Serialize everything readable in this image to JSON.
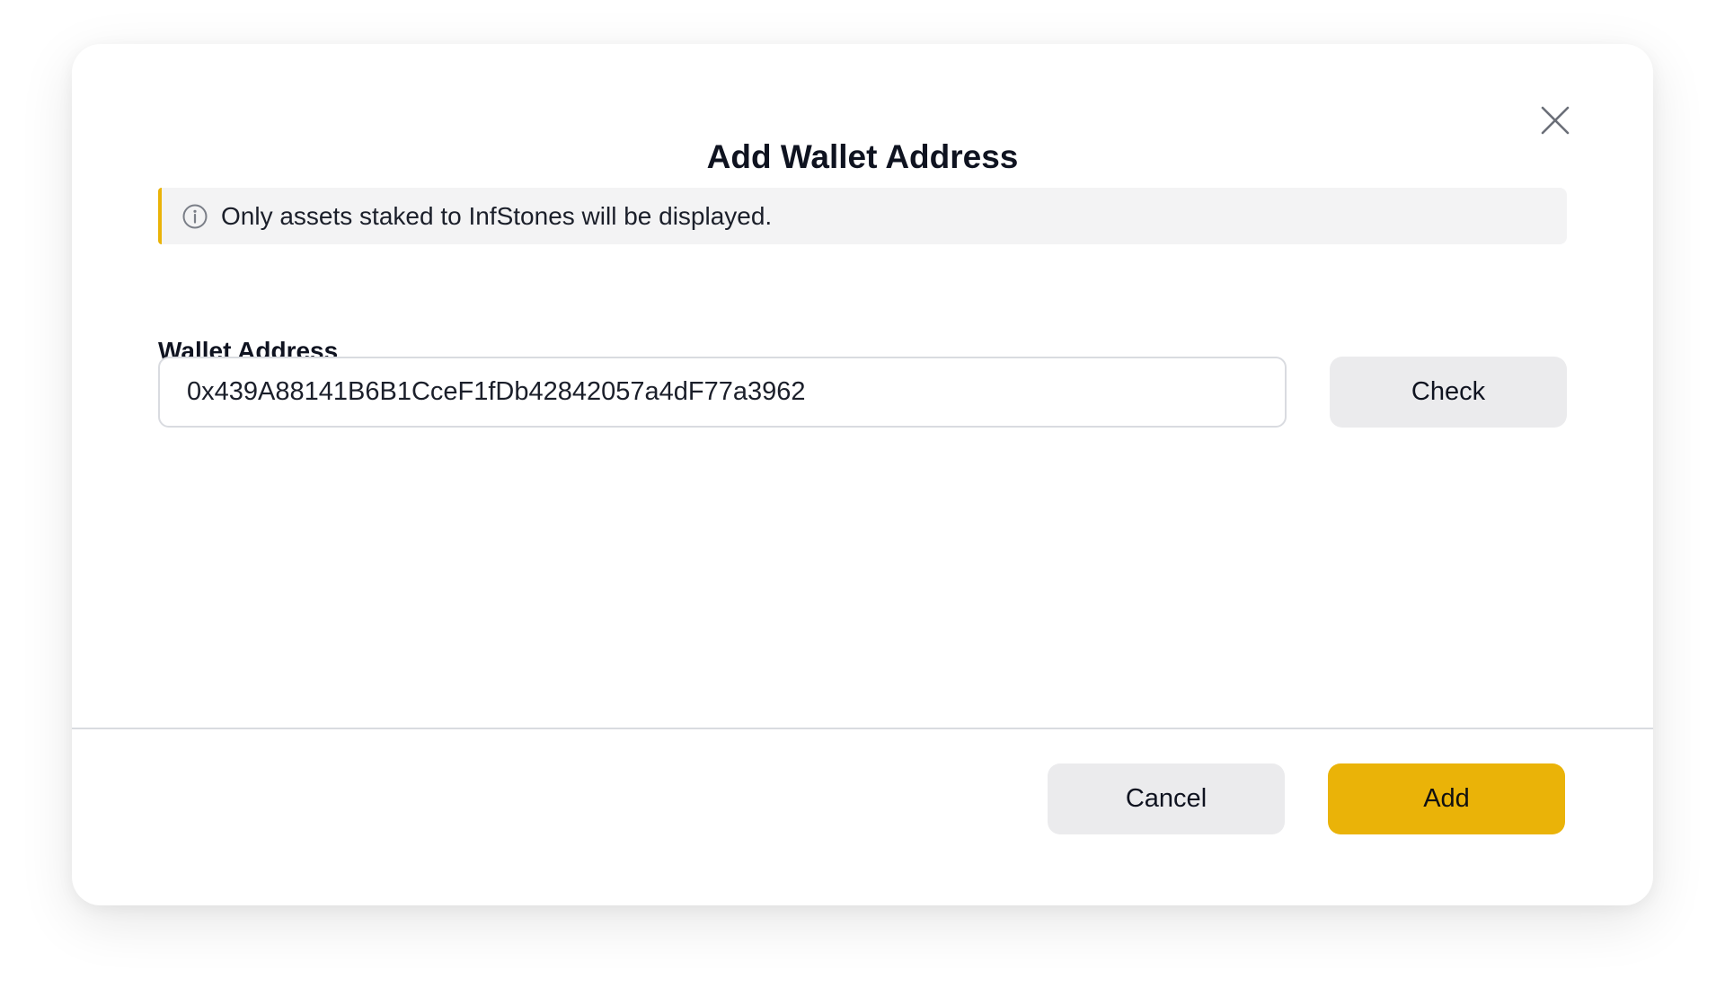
{
  "dialog": {
    "title": "Add Wallet Address",
    "close_icon": "close-icon"
  },
  "notice": {
    "icon": "info-icon",
    "text": "Only assets staked to InfStones will be displayed.",
    "accent_color": "#eab308"
  },
  "wallet": {
    "label": "Wallet Address",
    "value": "0x439A88141B6B1CceF1fDb42842057a4dF77a3962",
    "check_label": "Check"
  },
  "footer": {
    "cancel_label": "Cancel",
    "add_label": "Add",
    "primary_color": "#eab308"
  }
}
